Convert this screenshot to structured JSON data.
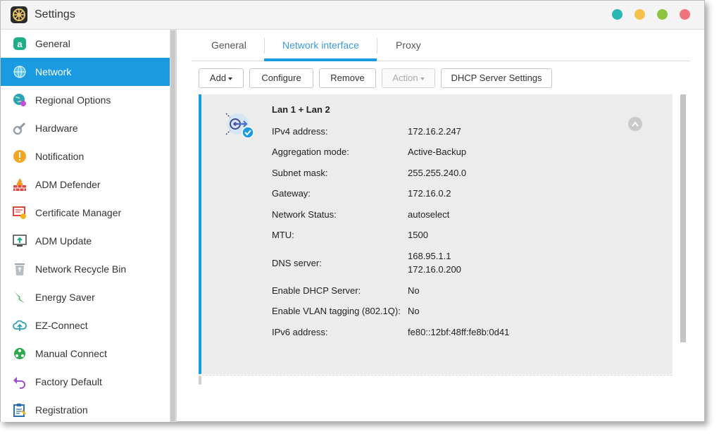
{
  "window": {
    "title": "Settings"
  },
  "window_controls": [
    {
      "name": "teal-control",
      "color": "#2ab7b3"
    },
    {
      "name": "yellow-control",
      "color": "#f5c04a"
    },
    {
      "name": "green-control",
      "color": "#8cc63f"
    },
    {
      "name": "red-control",
      "color": "#f2727b"
    }
  ],
  "sidebar": {
    "items": [
      {
        "label": "General",
        "icon": "general-icon"
      },
      {
        "label": "Network",
        "icon": "globe-icon",
        "active": true
      },
      {
        "label": "Regional Options",
        "icon": "regional-globe-icon"
      },
      {
        "label": "Hardware",
        "icon": "hardware-wrench-icon"
      },
      {
        "label": "Notification",
        "icon": "warning-icon"
      },
      {
        "label": "ADM Defender",
        "icon": "firewall-icon"
      },
      {
        "label": "Certificate Manager",
        "icon": "certificate-icon"
      },
      {
        "label": "ADM Update",
        "icon": "update-monitor-icon"
      },
      {
        "label": "Network Recycle Bin",
        "icon": "recycle-bin-icon"
      },
      {
        "label": "Energy Saver",
        "icon": "lightning-icon"
      },
      {
        "label": "EZ-Connect",
        "icon": "cloud-upload-icon"
      },
      {
        "label": "Manual Connect",
        "icon": "network-nodes-icon"
      },
      {
        "label": "Factory Default",
        "icon": "undo-arrow-icon"
      },
      {
        "label": "Registration",
        "icon": "clipboard-icon"
      }
    ]
  },
  "tabs": [
    {
      "label": "General"
    },
    {
      "label": "Network interface",
      "active": true
    },
    {
      "label": "Proxy"
    }
  ],
  "toolbar": {
    "add": "Add",
    "configure": "Configure",
    "remove": "Remove",
    "action": "Action",
    "dhcp": "DHCP Server Settings"
  },
  "interface": {
    "title": "Lan 1 + Lan 2",
    "icon": "network-link-check-icon",
    "fields": [
      {
        "label": "IPv4 address:",
        "value": "172.16.2.247"
      },
      {
        "label": "Aggregation mode:",
        "value": "Active-Backup"
      },
      {
        "label": "Subnet mask:",
        "value": "255.255.240.0"
      },
      {
        "label": "Gateway:",
        "value": "172.16.0.2"
      },
      {
        "label": "Network Status:",
        "value": "autoselect"
      },
      {
        "label": "MTU:",
        "value": "1500"
      },
      {
        "label": "DNS server:",
        "value": "168.95.1.1",
        "value2": "172.16.0.200"
      },
      {
        "label": "Enable DHCP Server:",
        "value": "No"
      },
      {
        "label": "Enable VLAN tagging (802.1Q):",
        "value": "No"
      },
      {
        "label": "IPv6 address:",
        "value": "fe80::12bf:48ff:fe8b:0d41"
      }
    ]
  }
}
